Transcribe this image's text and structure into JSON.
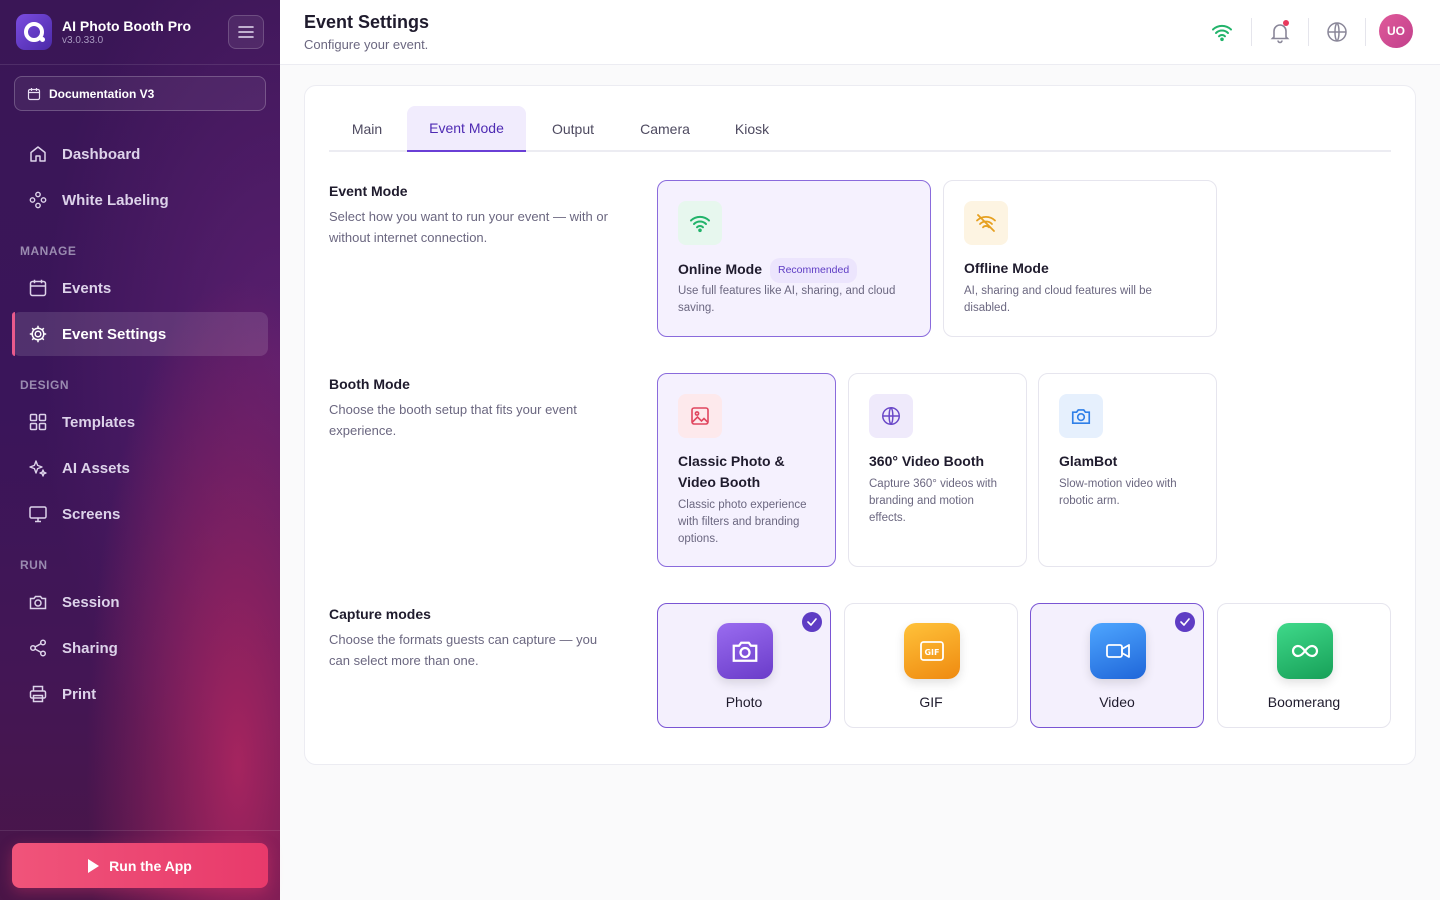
{
  "app": {
    "name": "AI Photo Booth Pro",
    "version": "v3.0.33.0"
  },
  "sidebar": {
    "project": "Documentation V3",
    "top_items": [
      {
        "label": "Dashboard",
        "icon": "home-icon"
      },
      {
        "label": "White Labeling",
        "icon": "palette-icon"
      }
    ],
    "sections": {
      "manage": "MANAGE",
      "design": "DESIGN",
      "run": "RUN"
    },
    "manage_items": [
      {
        "label": "Events",
        "icon": "calendar-icon"
      },
      {
        "label": "Event Settings",
        "icon": "gear-icon",
        "active": true
      }
    ],
    "design_items": [
      {
        "label": "Templates",
        "icon": "grid-icon"
      },
      {
        "label": "AI Assets",
        "icon": "sparkles-icon"
      },
      {
        "label": "Screens",
        "icon": "monitor-icon"
      }
    ],
    "run_items": [
      {
        "label": "Session",
        "icon": "camera-icon"
      },
      {
        "label": "Sharing",
        "icon": "share-icon"
      },
      {
        "label": "Print",
        "icon": "printer-icon"
      }
    ],
    "run_button": "Run the App"
  },
  "header": {
    "title": "Event Settings",
    "subtitle": "Configure your event.",
    "avatar": "UO"
  },
  "tabs": [
    {
      "label": "Main"
    },
    {
      "label": "Event Mode",
      "active": true
    },
    {
      "label": "Output"
    },
    {
      "label": "Camera"
    },
    {
      "label": "Kiosk"
    }
  ],
  "event_mode": {
    "title": "Event Mode",
    "description": "Select how you want to run your event — with or without internet connection.",
    "options": [
      {
        "title": "Online Mode",
        "badge": "Recommended",
        "description": "Use full features like AI, sharing, and cloud saving.",
        "selected": true,
        "icon": "wifi-icon"
      },
      {
        "title": "Offline Mode",
        "description": "AI, sharing and cloud features will be disabled.",
        "selected": false,
        "icon": "wifi-off-icon"
      }
    ]
  },
  "booth_mode": {
    "title": "Booth Mode",
    "description": "Choose the booth setup that fits your event experience.",
    "options": [
      {
        "title": "Classic Photo & Video Booth",
        "description": "Classic photo experience with filters and branding options.",
        "selected": true,
        "icon": "image-icon"
      },
      {
        "title": "360° Video Booth",
        "description": "Capture 360° videos with branding and motion effects.",
        "selected": false,
        "icon": "globe-icon"
      },
      {
        "title": "GlamBot",
        "description": "Slow-motion video with robotic arm.",
        "selected": false,
        "icon": "camera-icon"
      }
    ]
  },
  "capture_modes": {
    "title": "Capture modes",
    "description": "Choose the formats guests can capture — you can select more than one.",
    "options": [
      {
        "label": "Photo",
        "selected": true,
        "icon": "camera-icon",
        "color": "#7b4fd8"
      },
      {
        "label": "GIF",
        "selected": false,
        "icon": "gif-icon",
        "color": "#f29a17"
      },
      {
        "label": "Video",
        "selected": true,
        "icon": "video-icon",
        "color": "#2f7fe8"
      },
      {
        "label": "Boomerang",
        "selected": false,
        "icon": "infinity-icon",
        "color": "#22b36a"
      }
    ]
  },
  "colors": {
    "accent": "#5e3cc4",
    "sidebar": "#3a1656",
    "run": "#e83a6b"
  }
}
